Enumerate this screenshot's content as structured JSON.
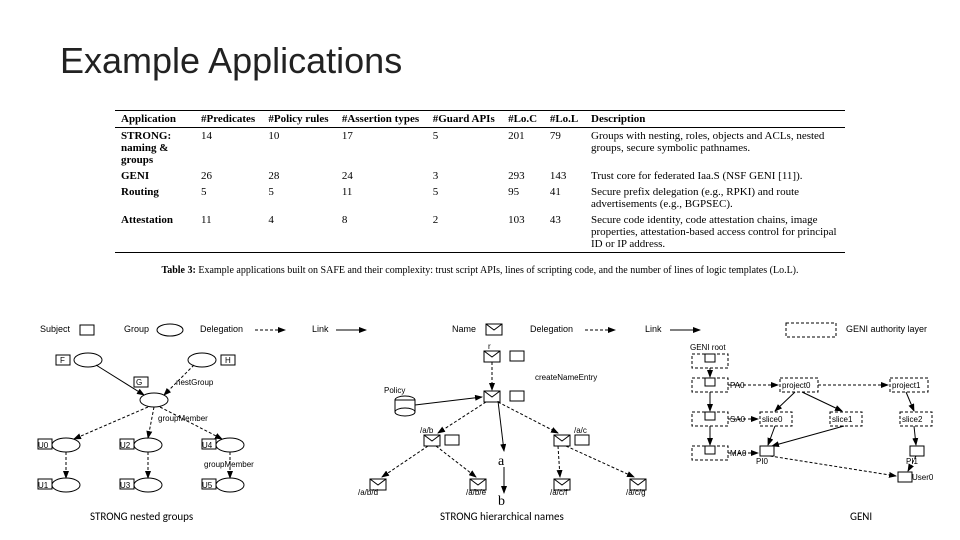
{
  "title": "Example Applications",
  "table": {
    "headers": [
      "Application",
      "#Predicates",
      "#Policy rules",
      "#Assertion types",
      "#Guard APIs",
      "#Lo.C",
      "#Lo.L",
      "Description"
    ],
    "rows": [
      {
        "app": "STRONG: naming & groups",
        "pred": "14",
        "pol": "10",
        "ass": "17",
        "gua": "5",
        "loc": "201",
        "lol": "79",
        "desc": "Groups with nesting, roles, objects and ACLs, nested groups, secure symbolic pathnames."
      },
      {
        "app": "GENI",
        "pred": "26",
        "pol": "28",
        "ass": "24",
        "gua": "3",
        "loc": "293",
        "lol": "143",
        "desc": "Trust core for federated Iaa.S (NSF GENI [11])."
      },
      {
        "app": "Routing",
        "pred": "5",
        "pol": "5",
        "ass": "11",
        "gua": "5",
        "loc": "95",
        "lol": "41",
        "desc": "Secure prefix delegation (e.g., RPKI) and route advertisements (e.g., BGPSEC)."
      },
      {
        "app": "Attestation",
        "pred": "11",
        "pol": "4",
        "ass": "8",
        "gua": "2",
        "loc": "103",
        "lol": "43",
        "desc": "Secure code identity, code attestation chains, image properties, attestation-based access control for principal ID or IP address."
      }
    ],
    "caption_bold": "Table 3:",
    "caption_rest": " Example applications built on SAFE and their complexity: trust script APIs, lines of scripting code, and the number of lines of logic templates (Lo.L)."
  },
  "legend_left": {
    "subject": "Subject",
    "group": "Group",
    "delegation": "Delegation",
    "link": "Link"
  },
  "legend_right": {
    "name": "Name",
    "delegation": "Delegation",
    "link": "Link",
    "auth": "GENI authority layer"
  },
  "left": {
    "f": "F",
    "h": "H",
    "g": "G",
    "nest": "nestGroup",
    "gm": "groupMember",
    "u0": "U0",
    "u1": "U1",
    "u2": "U2",
    "u3": "U3",
    "u4": "U4",
    "u5": "U5",
    "cap": "STRONG nested groups"
  },
  "mid": {
    "policy": "Policy",
    "r": "r",
    "ab": "/a/b",
    "ac": "/a/c",
    "abd": "/a/b/d",
    "abe": "/a/b/e",
    "acf": "/a/c/f",
    "acg": "/a/c/g",
    "a": "a",
    "b": "b",
    "create": "createNameEntry",
    "cap": "STRONG hierarchical names"
  },
  "right": {
    "root": "GENI root",
    "pa0": "PA0",
    "sa0": "SA0",
    "ma0": "MA0",
    "p0": "project0",
    "p1": "project1",
    "s0": "slice0",
    "s1": "slice1",
    "s2": "slice2",
    "pi0": "PI0",
    "pi1": "PI1",
    "user0": "User0",
    "cap": "GENI"
  }
}
